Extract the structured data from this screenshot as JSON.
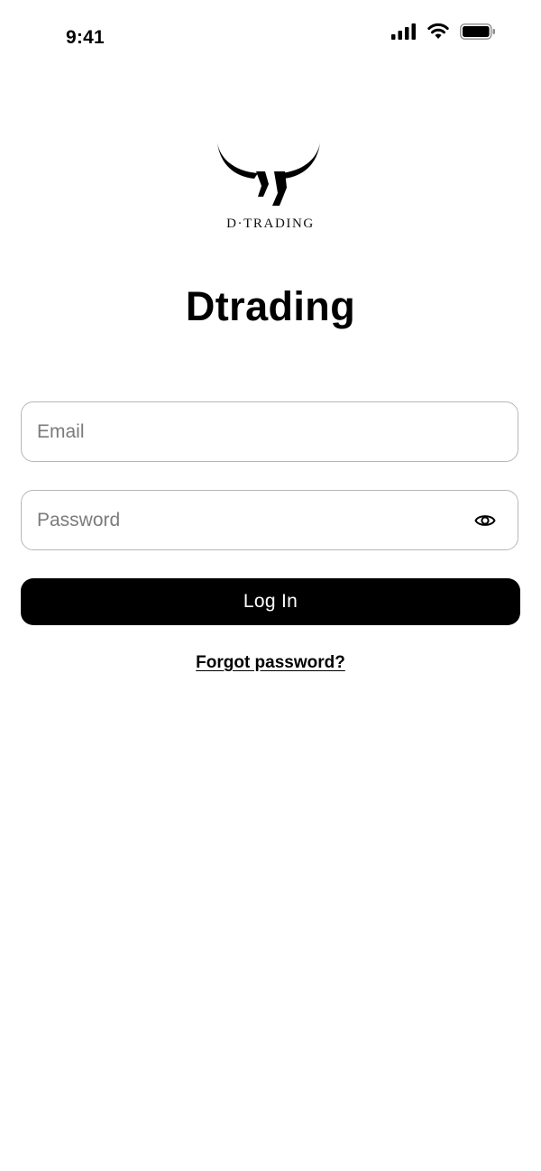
{
  "status_bar": {
    "time": "9:41",
    "icons": [
      "cellular-signal-icon",
      "wifi-icon",
      "battery-icon"
    ]
  },
  "logo": {
    "icon": "bull-horns-icon",
    "wordmark": "D·TRADING"
  },
  "app_title": "Dtrading",
  "form": {
    "email_placeholder": "Email",
    "password_placeholder": "Password",
    "password_toggle_icon": "eye-icon",
    "login_label": "Log In",
    "forgot_label": "Forgot password?"
  },
  "colors": {
    "background": "#ffffff",
    "primary": "#000000",
    "field_border": "#b7b7b7",
    "placeholder": "#7b7b7b"
  }
}
